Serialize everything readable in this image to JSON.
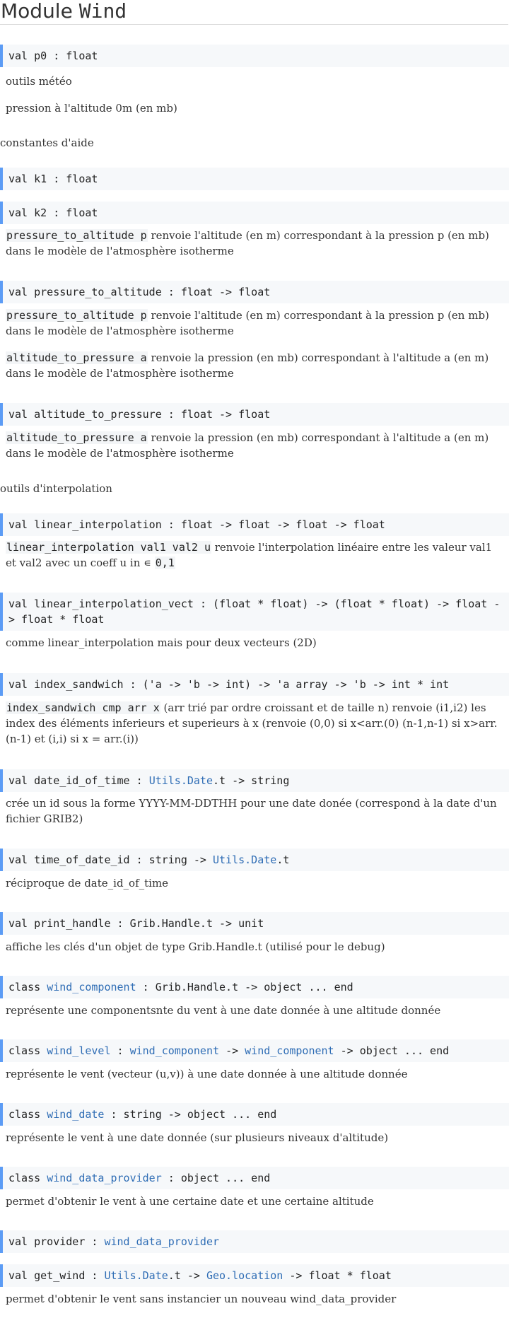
{
  "title": {
    "prefix": "Module",
    "name": "Wind"
  },
  "items": {
    "p0_spec": {
      "kw": "val",
      "name": "p0",
      "type": ": float"
    },
    "p0_doc1": "outils météo",
    "p0_doc2": "pression à l'altitude 0m (en mb)",
    "section_aide": "constantes d'aide",
    "k1_spec": {
      "kw": "val",
      "name": "k1",
      "type": ": float"
    },
    "k2_spec": {
      "kw": "val",
      "name": "k2",
      "type": ": float"
    },
    "k2_doc": {
      "code": "pressure_to_altitude p",
      "text": " renvoie l'altitude (en m) correspondant à la pression p (en mb) dans le modèle de l'atmosphère isotherme"
    },
    "pta_spec": {
      "kw": "val",
      "name": "pressure_to_altitude",
      "type": ": float -> float"
    },
    "pta_doc1": {
      "code": "pressure_to_altitude p",
      "text": " renvoie l'altitude (en m) correspondant à la pression p (en mb) dans le modèle de l'atmosphère isotherme"
    },
    "pta_doc2": {
      "code": "altitude_to_pressure a",
      "text": " renvoie la pression (en mb) correspondant à l'altitude a (en m) dans le modèle de l'atmosphère isotherme"
    },
    "atp_spec": {
      "kw": "val",
      "name": "altitude_to_pressure",
      "type": ": float -> float"
    },
    "atp_doc": {
      "code": "altitude_to_pressure a",
      "text": " renvoie la pression (en mb) correspondant à l'altitude a (en m) dans le modèle de l'atmosphère isotherme"
    },
    "section_interp": "outils d'interpolation",
    "li_spec": {
      "kw": "val",
      "name": "linear_interpolation",
      "type": ": float -> float -> float -> float"
    },
    "li_doc": {
      "code": "linear_interpolation val1 val2 u",
      "text": " renvoie l'interpolation linéaire entre les valeur val1 et val2 avec un coeff u in ",
      "sym": "∊",
      "code2": "0,1"
    },
    "liv_spec": {
      "kw": "val",
      "name": "linear_interpolation_vect",
      "type": ": (float * float) -> (float * float) -> float -> float * float"
    },
    "liv_doc": "comme linear_interpolation mais pour deux vecteurs (2D)",
    "is_spec": {
      "kw": "val",
      "name": "index_sandwich",
      "type": ": ('a -> 'b -> int) -> 'a array -> 'b -> int * int"
    },
    "is_doc": {
      "code": "index_sandwich cmp arr x",
      "text": " (arr trié par ordre croissant et de taille n) renvoie (i1,i2) les index des éléments inferieurs et superieurs à x (renvoie (0,0) si x<arr.(0) (n-1,n-1) si x>arr.(n-1) et (i,i) si x = arr.(i))"
    },
    "didt_spec": {
      "kw": "val",
      "name": "date_id_of_time",
      "colon": ":",
      "link1": "Utils.Date",
      "rest": ".t -> string"
    },
    "didt_doc": "crée un id sous la forme YYYY-MM-DDTHH pour une date donée (correspond à la date d'un fichier GRIB2)",
    "todi_spec": {
      "kw": "val",
      "name": "time_of_date_id",
      "pre": ": string ->",
      "link1": "Utils.Date",
      "rest": ".t"
    },
    "todi_doc": "réciproque de date_id_of_time",
    "ph_spec": {
      "kw": "val",
      "name": "print_handle",
      "type": ": Grib.Handle.t -> unit"
    },
    "ph_doc": "affiche les clés d'un objet de type Grib.Handle.t (utilisé pour le debug)",
    "wc_spec": {
      "kw": "class",
      "name": "wind_component",
      "mid": ": Grib.Handle.t ->",
      "obj": "object ... end"
    },
    "wc_doc": "représente une componentsnte du vent à une date donnée à une altitude donnée",
    "wl_spec": {
      "kw": "class",
      "name": "wind_level",
      "c1": ":",
      "l1": "wind_component",
      "c2": "->",
      "l2": "wind_component",
      "c3": "->",
      "obj": "object ... end"
    },
    "wl_doc": "représente le vent (vecteur (u,v)) à une date donnée à une altitude donnée",
    "wd_spec": {
      "kw": "class",
      "name": "wind_date",
      "mid": ": string ->",
      "obj": "object ... end"
    },
    "wd_doc": "représente le vent à une date donnée (sur plusieurs niveaux d'altitude)",
    "wdp_spec": {
      "kw": "class",
      "name": "wind_data_provider",
      "mid": ":",
      "obj": "object ... end"
    },
    "wdp_doc": "permet d'obtenir le vent à une certaine date et une certaine altitude",
    "prov_spec": {
      "kw": "val",
      "name": "provider",
      "colon": ":",
      "link1": "wind_data_provider"
    },
    "gw_spec": {
      "kw": "val",
      "name": "get_wind",
      "colon": ":",
      "link1": "Utils.Date",
      "mid": ".t ->",
      "link2": "Geo.location",
      "rest": "-> float * float"
    },
    "gw_doc": "permet d'obtenir le vent sans instancier un nouveau wind_data_provider"
  }
}
